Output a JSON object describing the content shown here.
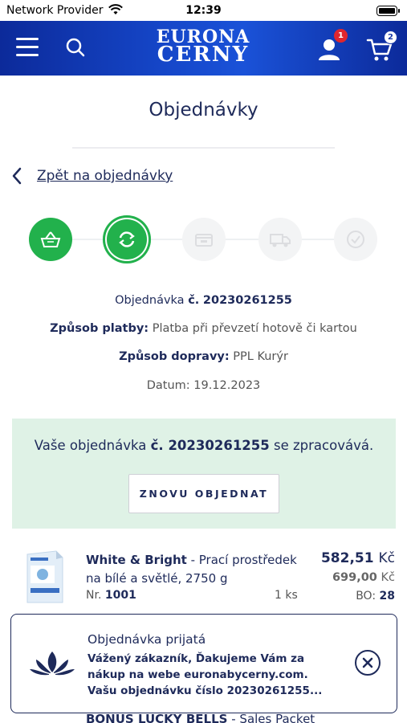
{
  "statusbar": {
    "carrier": "Network Provider",
    "time": "12:39"
  },
  "header": {
    "logo_line1": "EURONA",
    "logo_line2": "CERNY",
    "user_badge": "1",
    "cart_badge": "2"
  },
  "page": {
    "title": "Objednávky",
    "back_label": "Zpět na objednávky"
  },
  "steps": [
    {
      "icon": "basket-icon",
      "state": "done"
    },
    {
      "icon": "refresh-icon",
      "state": "active"
    },
    {
      "icon": "box-icon",
      "state": "todo"
    },
    {
      "icon": "truck-icon",
      "state": "todo"
    },
    {
      "icon": "check-icon",
      "state": "todo"
    }
  ],
  "order": {
    "number_label": "Objednávka",
    "number_prefix": "č.",
    "number": "20230261255",
    "payment_label": "Způsob platby:",
    "payment_value": "Platba při převzetí hotově či kartou",
    "delivery_label": "Způsob dopravy:",
    "delivery_value": "PPL Kurýr",
    "date_label": "Datum:",
    "date_value": "19.12.2023"
  },
  "status": {
    "msg_pre": "Vaše objednávka",
    "msg_num": "č. 20230261255",
    "msg_post": "se zpracovává.",
    "reorder_label": "ZNOVU OBJEDNAT"
  },
  "product": {
    "name_bold": "White & Bright",
    "name_rest": " - Prací prostředek na bílé a světlé, 2750 g",
    "nr_label": "Nr.",
    "nr_value": "1001",
    "qty": "1 ks",
    "price": "582,51",
    "price_currency": "Kč",
    "old_price": "699,00",
    "old_currency": "Kč",
    "bo_label": "BO:",
    "bo_value": "28"
  },
  "product2": {
    "name_bold": "BONUS LUCKY BELLS",
    "name_rest": " - Sales Packet"
  },
  "toast": {
    "title": "Objednávka prijatá",
    "body": "Vážený zákazník, Ďakujeme Vám za nákup na webe euronabycerny.com. Vašu objednávku číslo 20230261255..."
  },
  "colors": {
    "header": "#1546c8",
    "success": "#22b14c",
    "status_bg": "#dff2e6",
    "text": "#1e2a5a",
    "badge": "#e0262d"
  }
}
